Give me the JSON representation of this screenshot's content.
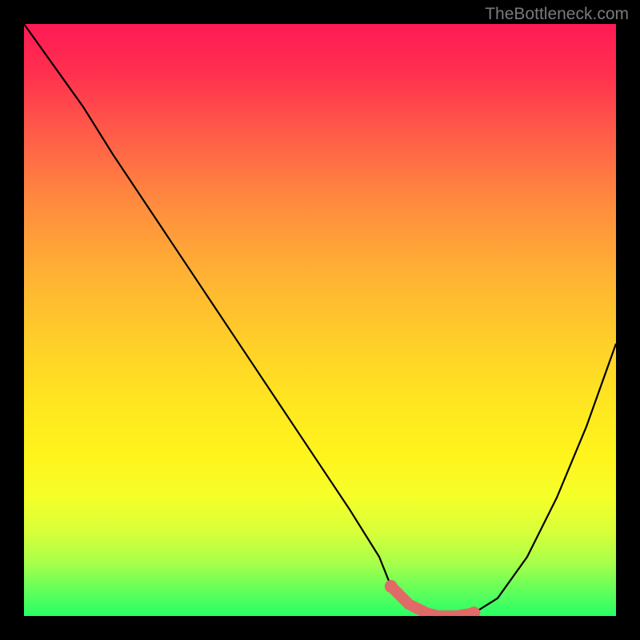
{
  "watermark": "TheBottleneck.com",
  "chart_data": {
    "type": "line",
    "title": "",
    "xlabel": "",
    "ylabel": "",
    "xlim": [
      0,
      100
    ],
    "ylim": [
      0,
      100
    ],
    "x": [
      0,
      5,
      10,
      15,
      20,
      25,
      30,
      35,
      40,
      45,
      50,
      55,
      60,
      62,
      65,
      68,
      70,
      73,
      76,
      80,
      85,
      90,
      95,
      100
    ],
    "values": [
      100,
      93,
      86,
      78,
      70.5,
      63,
      55.5,
      48,
      40.5,
      33,
      25.5,
      18,
      10,
      5,
      2,
      0.5,
      0,
      0,
      0.5,
      3,
      10,
      20,
      32,
      46
    ],
    "marker_segment": {
      "color": "#e06a67",
      "x": [
        62,
        65,
        68,
        70,
        73,
        76
      ],
      "values": [
        5,
        2,
        0.5,
        0,
        0,
        0.5
      ]
    },
    "gradient_stops": [
      {
        "pct": 0,
        "color": "#ff1a55"
      },
      {
        "pct": 18,
        "color": "#ff5a49"
      },
      {
        "pct": 42,
        "color": "#ffb134"
      },
      {
        "pct": 65,
        "color": "#ffe820"
      },
      {
        "pct": 86,
        "color": "#d6ff3a"
      },
      {
        "pct": 100,
        "color": "#28ff66"
      }
    ]
  }
}
